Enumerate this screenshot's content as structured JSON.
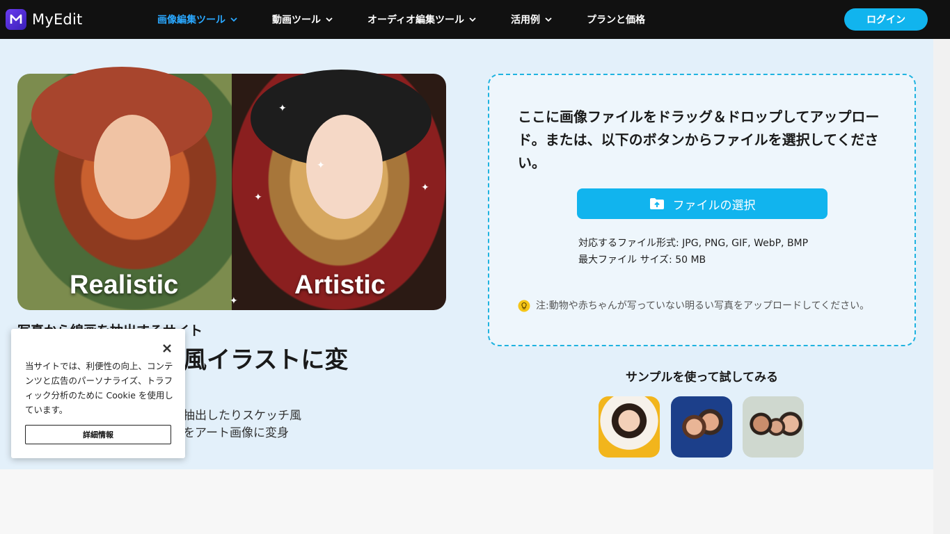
{
  "header": {
    "logo_text": "MyEdit",
    "nav": [
      {
        "label": "画像編集ツール",
        "active": true
      },
      {
        "label": "動画ツール"
      },
      {
        "label": "オーディオ編集ツール"
      },
      {
        "label": "活用例"
      },
      {
        "label": "プランと価格"
      }
    ],
    "login_label": "ログイン"
  },
  "hero": {
    "label_left": "Realistic",
    "label_right": "Artistic"
  },
  "intro": {
    "subhead": "写真から線画を抽出するサイト",
    "headline": "写真をスケッチ風イラストに変",
    "description_line1": "ワンクリックで写真から線画を抽出したりスケッチ風",
    "description_line2": "にできます！お気に入りの写真をアート画像に変身"
  },
  "upload": {
    "title": "ここに画像ファイルをドラッグ＆ドロップしてアップロード。または、以下のボタンからファイルを選択してください。",
    "button_label": "ファイルの選択",
    "formats": "対応するファイル形式: JPG, PNG, GIF, WebP, BMP",
    "max_size": "最大ファイル サイズ: 50 MB",
    "note": "注:動物や赤ちゃんが写っていない明るい写真をアップロードしてください。"
  },
  "samples": {
    "title": "サンプルを使って試してみる"
  },
  "cookie": {
    "text": "当サイトでは、利便性の向上、コンテンツと広告のパーソナライズ、トラフィック分析のために Cookie を使用しています。",
    "button_label": "詳細情報"
  },
  "colors": {
    "accent": "#11b4ee",
    "header_bg": "#111111",
    "main_bg": "#e3f0fa",
    "nav_active": "#2aa8ff"
  }
}
